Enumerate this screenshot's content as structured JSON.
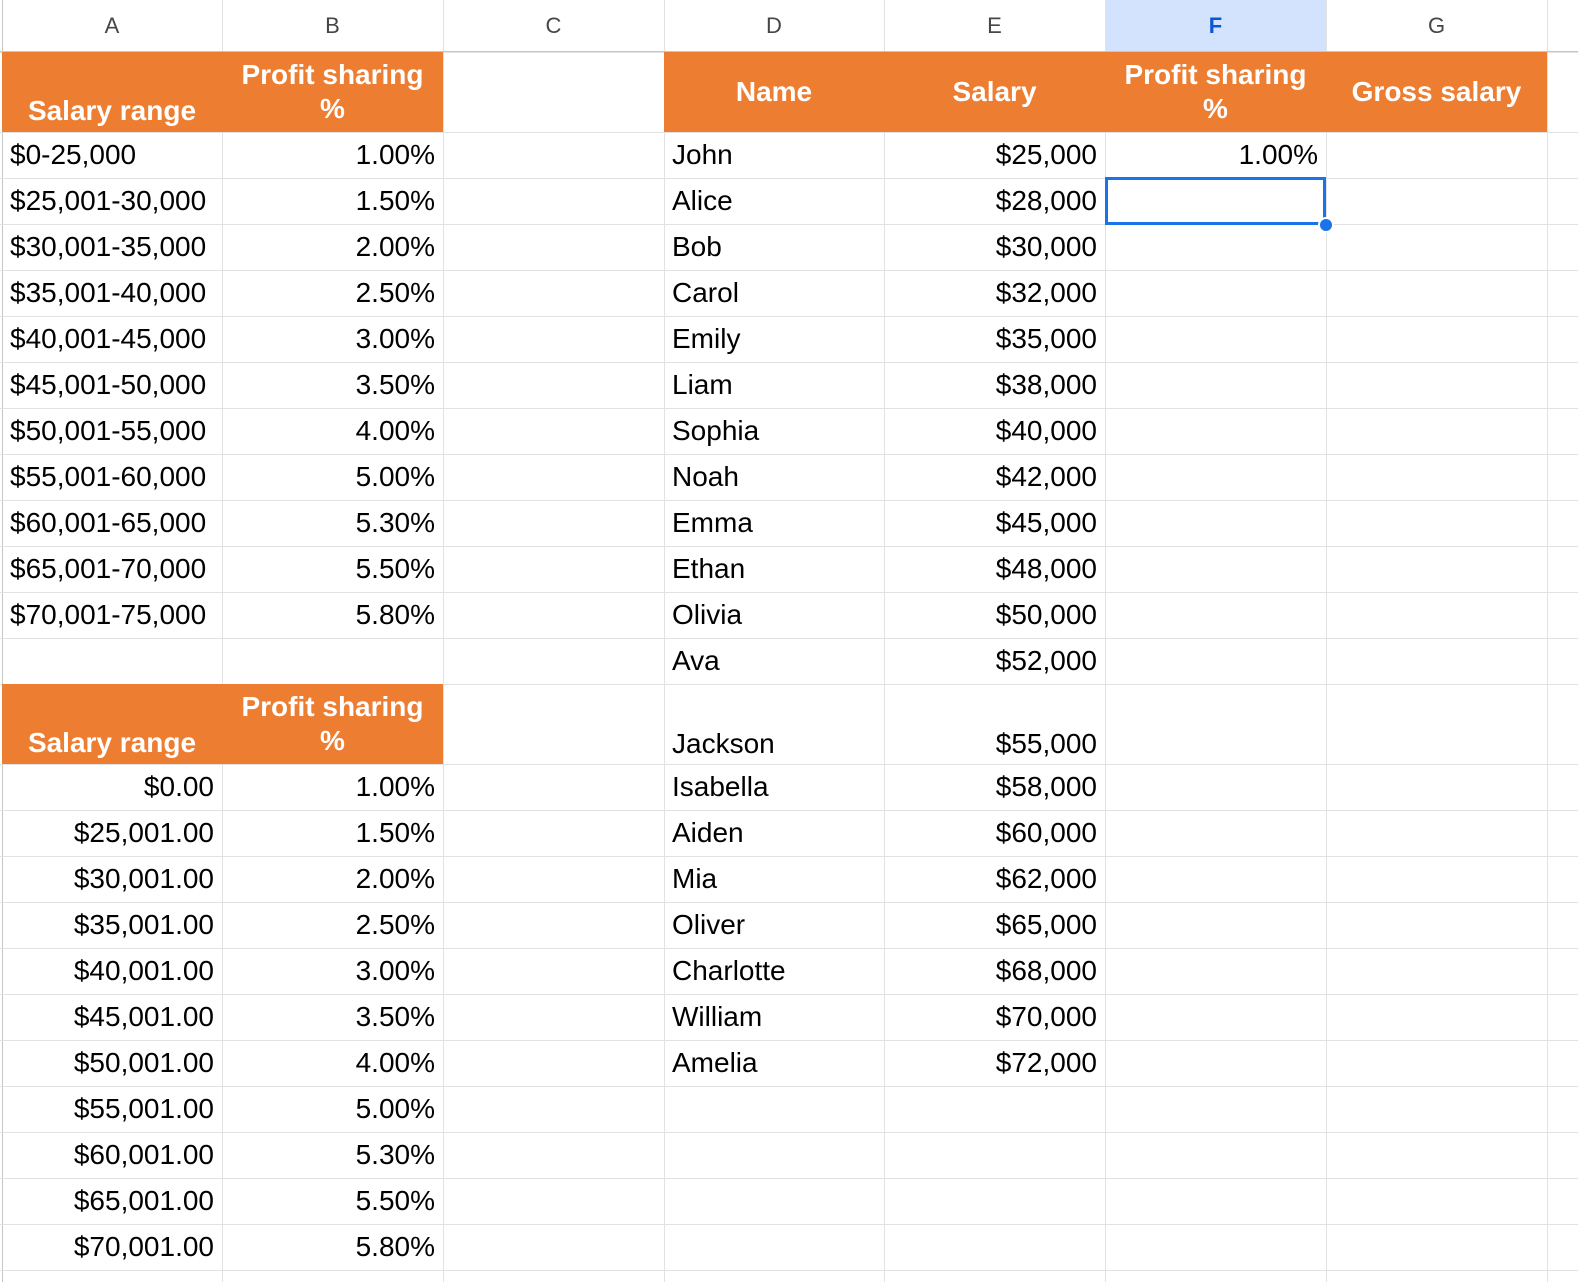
{
  "columns": [
    "A",
    "B",
    "C",
    "D",
    "E",
    "F",
    "G"
  ],
  "selected_column": "F",
  "top_table": {
    "header": [
      "Salary range",
      "Profit sharing\n%"
    ],
    "rows": [
      [
        "$0-25,000",
        "1.00%"
      ],
      [
        "$25,001-30,000",
        "1.50%"
      ],
      [
        "$30,001-35,000",
        "2.00%"
      ],
      [
        "$35,001-40,000",
        "2.50%"
      ],
      [
        "$40,001-45,000",
        "3.00%"
      ],
      [
        "$45,001-50,000",
        "3.50%"
      ],
      [
        "$50,001-55,000",
        "4.00%"
      ],
      [
        "$55,001-60,000",
        "5.00%"
      ],
      [
        "$60,001-65,000",
        "5.30%"
      ],
      [
        "$65,001-70,000",
        "5.50%"
      ],
      [
        "$70,001-75,000",
        "5.80%"
      ]
    ]
  },
  "bottom_table": {
    "header": [
      "Salary range",
      "Profit sharing\n%"
    ],
    "rows": [
      [
        "$0.00",
        "1.00%"
      ],
      [
        "$25,001.00",
        "1.50%"
      ],
      [
        "$30,001.00",
        "2.00%"
      ],
      [
        "$35,001.00",
        "2.50%"
      ],
      [
        "$40,001.00",
        "3.00%"
      ],
      [
        "$45,001.00",
        "3.50%"
      ],
      [
        "$50,001.00",
        "4.00%"
      ],
      [
        "$55,001.00",
        "5.00%"
      ],
      [
        "$60,001.00",
        "5.30%"
      ],
      [
        "$65,001.00",
        "5.50%"
      ],
      [
        "$70,001.00",
        "5.80%"
      ]
    ]
  },
  "employee_table": {
    "header": [
      "Name",
      "Salary",
      "Profit sharing\n%",
      "Gross salary"
    ],
    "rows": [
      [
        "John",
        "$25,000",
        "1.00%",
        ""
      ],
      [
        "Alice",
        "$28,000",
        "",
        ""
      ],
      [
        "Bob",
        "$30,000",
        "",
        ""
      ],
      [
        "Carol",
        "$32,000",
        "",
        ""
      ],
      [
        "Emily",
        "$35,000",
        "",
        ""
      ],
      [
        "Liam",
        "$38,000",
        "",
        ""
      ],
      [
        "Sophia",
        "$40,000",
        "",
        ""
      ],
      [
        "Noah",
        "$42,000",
        "",
        ""
      ],
      [
        "Emma",
        "$45,000",
        "",
        ""
      ],
      [
        "Ethan",
        "$48,000",
        "",
        ""
      ],
      [
        "Olivia",
        "$50,000",
        "",
        ""
      ],
      [
        "Ava",
        "$52,000",
        "",
        ""
      ],
      [
        "Jackson",
        "$55,000",
        "",
        ""
      ],
      [
        "Isabella",
        "$58,000",
        "",
        ""
      ],
      [
        "Aiden",
        "$60,000",
        "",
        ""
      ],
      [
        "Mia",
        "$62,000",
        "",
        ""
      ],
      [
        "Oliver",
        "$65,000",
        "",
        ""
      ],
      [
        "Charlotte",
        "$68,000",
        "",
        ""
      ],
      [
        "William",
        "$70,000",
        "",
        ""
      ],
      [
        "Amelia",
        "$72,000",
        "",
        ""
      ]
    ]
  },
  "colors": {
    "header_fill": "#ed7d31",
    "header_text": "#ffffff",
    "selection": "#1a73e8",
    "selected_column_fill": "#d3e3fd"
  }
}
